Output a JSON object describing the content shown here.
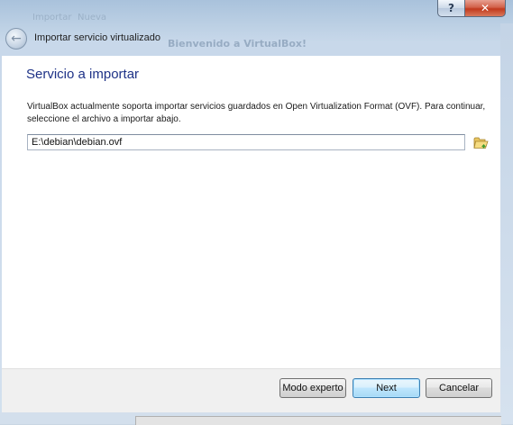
{
  "window": {
    "title": "Importar servicio virtualizado",
    "help_label": "?",
    "close_label": "✕",
    "background_ghost": {
      "title": "Bienvenido a VirtualBox!",
      "toolbar": [
        "Importar",
        "Nueva"
      ]
    }
  },
  "page": {
    "heading": "Servicio a importar",
    "description": "VirtualBox actualmente soporta importar servicios guardados en Open Virtualization Format (OVF). Para continuar, seleccione el archivo a importar abajo."
  },
  "file": {
    "path": "E:\\debian\\debian.ovf",
    "browse_icon": "folder-open-icon"
  },
  "buttons": {
    "expert": "Modo experto",
    "next": "Next",
    "cancel": "Cancelar"
  },
  "colors": {
    "heading": "#1e3287",
    "next_border": "#3c7fb1",
    "close_red": "#c13a1d"
  }
}
